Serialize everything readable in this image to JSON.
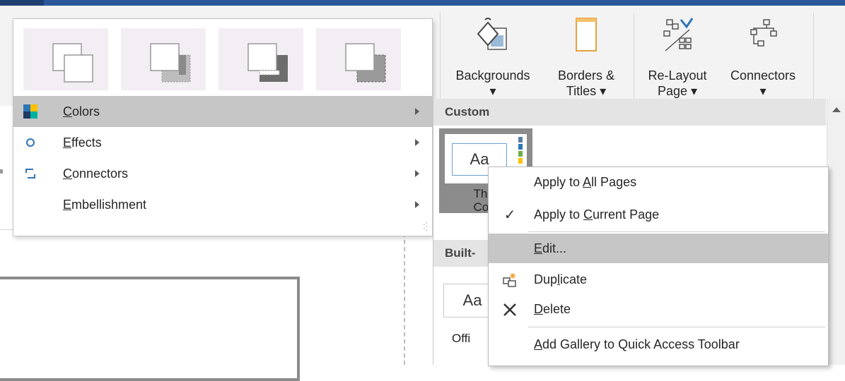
{
  "ribbon": {
    "buttons": [
      {
        "label1": "Backgrounds",
        "label2": ""
      },
      {
        "label1": "Borders &",
        "label2": "Titles"
      },
      {
        "label1": "Re-Layout",
        "label2": "Page"
      },
      {
        "label1": "Connectors",
        "label2": ""
      }
    ]
  },
  "variant_menu": {
    "items": [
      {
        "pre": "",
        "key": "C",
        "post": "olors",
        "icon": "color-squares-icon",
        "highlighted": true
      },
      {
        "pre": "",
        "key": "E",
        "post": "ffects",
        "icon": "effects-circle-icon",
        "highlighted": false
      },
      {
        "pre": "",
        "key": "C",
        "post": "onnectors",
        "icon": "connector-icon",
        "highlighted": false
      },
      {
        "pre": "",
        "key": "E",
        "post": "mbellishment",
        "icon": "",
        "highlighted": false
      }
    ]
  },
  "theme_panel": {
    "custom_header": "Custom",
    "builtin_header": "Built-",
    "custom_tile_aa": "Aa",
    "custom_tile_caption1": "Ther",
    "custom_tile_caption2": "Colo",
    "builtin_tile_aa": "Aa",
    "builtin_tile_caption": "Offi",
    "swatch_colors": [
      "#5b7ea6",
      "#2e75b6",
      "#70ad47",
      "#ffc000"
    ]
  },
  "context_menu": {
    "items": [
      {
        "pre": "Apply to ",
        "key": "A",
        "post": "ll Pages",
        "icon": ""
      },
      {
        "pre": "Apply to ",
        "key": "C",
        "post": "urrent Page",
        "icon": "checkmark-icon"
      },
      {
        "pre": "",
        "key": "E",
        "post": "dit...",
        "icon": ""
      },
      {
        "pre": "Dup",
        "key": "l",
        "post": "icate",
        "icon": "duplicate-icon"
      },
      {
        "pre": "",
        "key": "D",
        "post": "elete",
        "icon": "delete-x-icon"
      },
      {
        "pre": "",
        "key": "A",
        "post": "dd Gallery to Quick Access Toolbar",
        "icon": ""
      }
    ]
  }
}
